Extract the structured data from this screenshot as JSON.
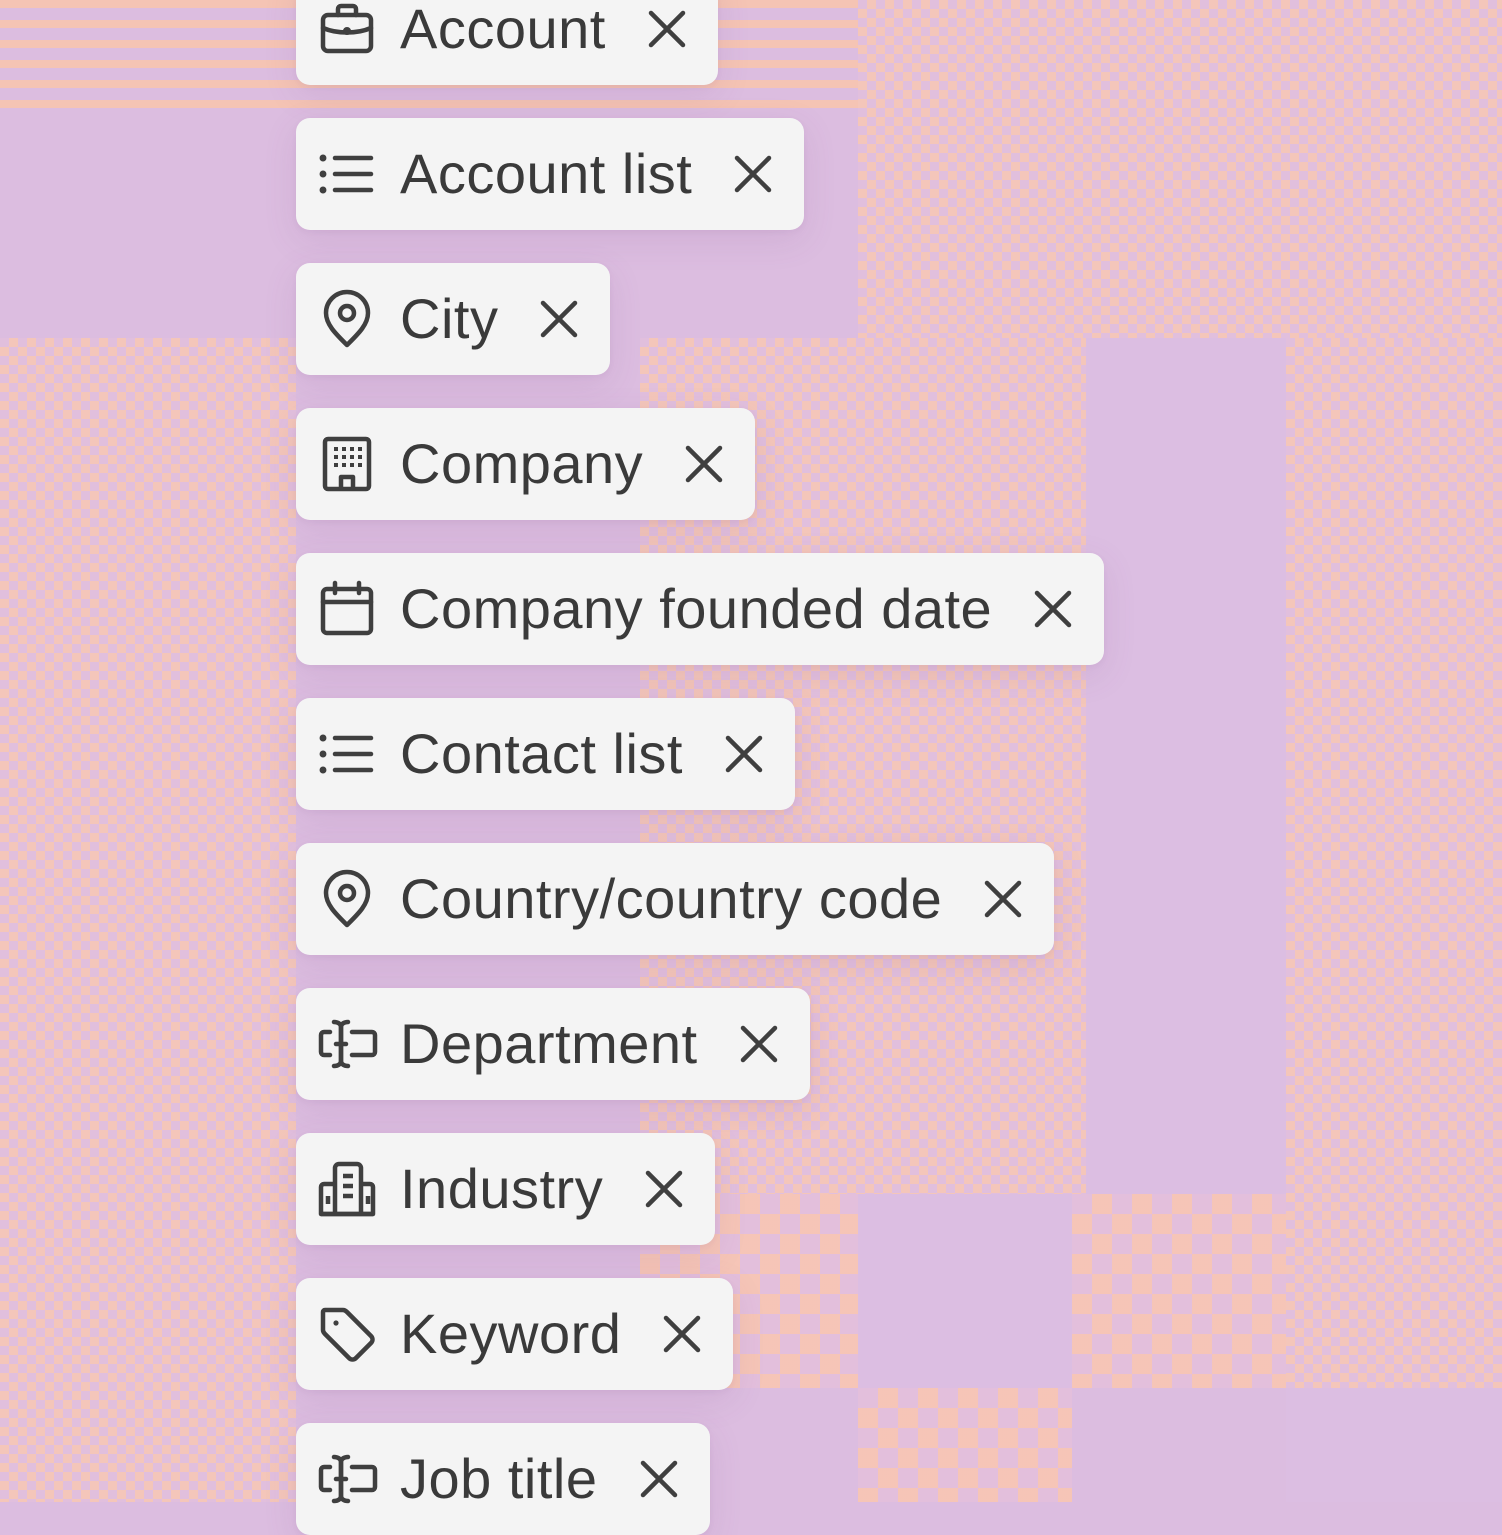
{
  "colors": {
    "background": "#dcbde0",
    "pattern_accent": "#f5c6b8",
    "chip_background": "#f4f4f4",
    "chip_text": "#3a3a3a",
    "icon_stroke": "#3f3f3f"
  },
  "filter_chips": [
    {
      "label": "Account",
      "icon": "briefcase-icon"
    },
    {
      "label": "Account list",
      "icon": "list-icon"
    },
    {
      "label": "City",
      "icon": "map-pin-icon"
    },
    {
      "label": "Company",
      "icon": "building-icon"
    },
    {
      "label": "Company founded date",
      "icon": "calendar-icon"
    },
    {
      "label": "Contact list",
      "icon": "list-icon"
    },
    {
      "label": "Country/country code",
      "icon": "map-pin-icon"
    },
    {
      "label": "Department",
      "icon": "text-cursor-icon"
    },
    {
      "label": "Industry",
      "icon": "industry-building-icon"
    },
    {
      "label": "Keyword",
      "icon": "tag-icon"
    },
    {
      "label": "Job title",
      "icon": "text-cursor-icon"
    }
  ],
  "remove_icon": "close-icon"
}
